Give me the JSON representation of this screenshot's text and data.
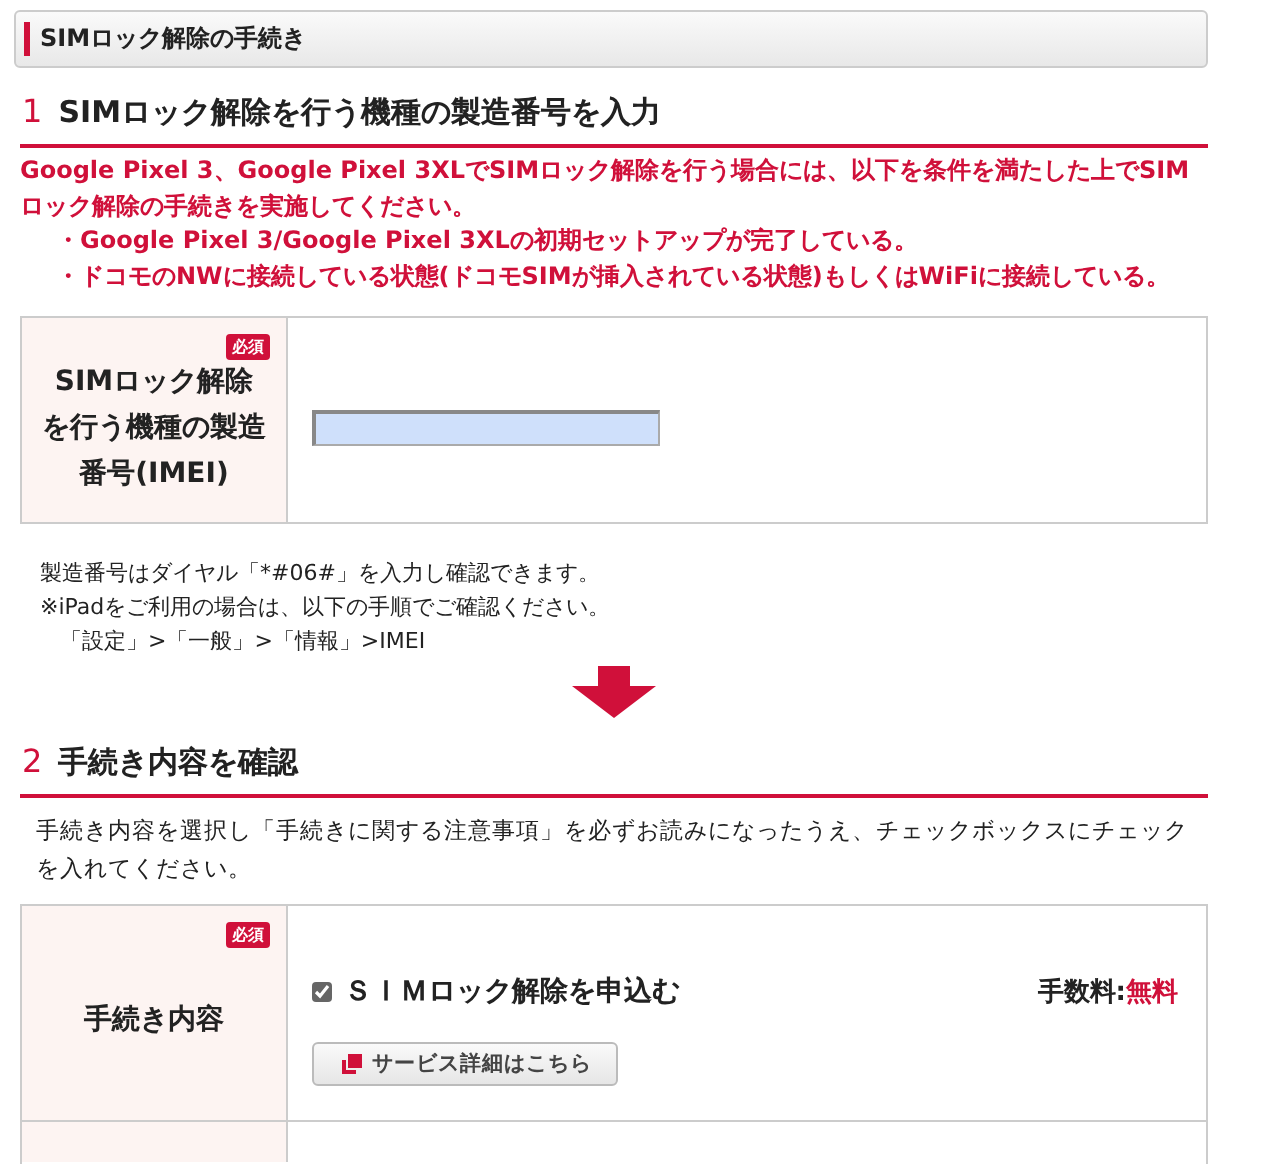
{
  "page_header": {
    "title": "SIMロック解除の手続き"
  },
  "step1": {
    "number": "1",
    "title": "SIMロック解除を行う機種の製造番号を入力",
    "notice": {
      "intro": "Google Pixel 3、Google Pixel 3XLでSIMロック解除を行う場合には、以下を条件を満たした上でSIMロック解除の手続きを実施してください。",
      "bullets": [
        "・Google Pixel 3/Google Pixel 3XLの初期セットアップが完了している。",
        "・ドコモのNWに接続している状態(ドコモSIMが挿入されている状態)もしくはWiFiに接続している。"
      ]
    },
    "field": {
      "label": "SIMロック解除を行う機種の製造番号(IMEI)",
      "badge": "必須"
    },
    "notes": [
      "製造番号はダイヤル「*#06#」を入力し確認できます。",
      "※iPadをご利用の場合は、以下の手順でご確認ください。",
      "「設定」>「一般」>「情報」>IMEI"
    ]
  },
  "step2": {
    "number": "2",
    "title": "手続き内容を確認",
    "instruction": "手続き内容を選択し「手続きに関する注意事項」を必ずお読みになったうえ、チェックボックスにチェックを入れてください。",
    "row": {
      "label": "手続き内容",
      "badge": "必須",
      "option": {
        "label": "ＳＩＭロック解除を申込む",
        "checked": true
      },
      "fee_label": "手数料:",
      "fee_value": "無料",
      "button": "サービス詳細はこちら"
    }
  }
}
